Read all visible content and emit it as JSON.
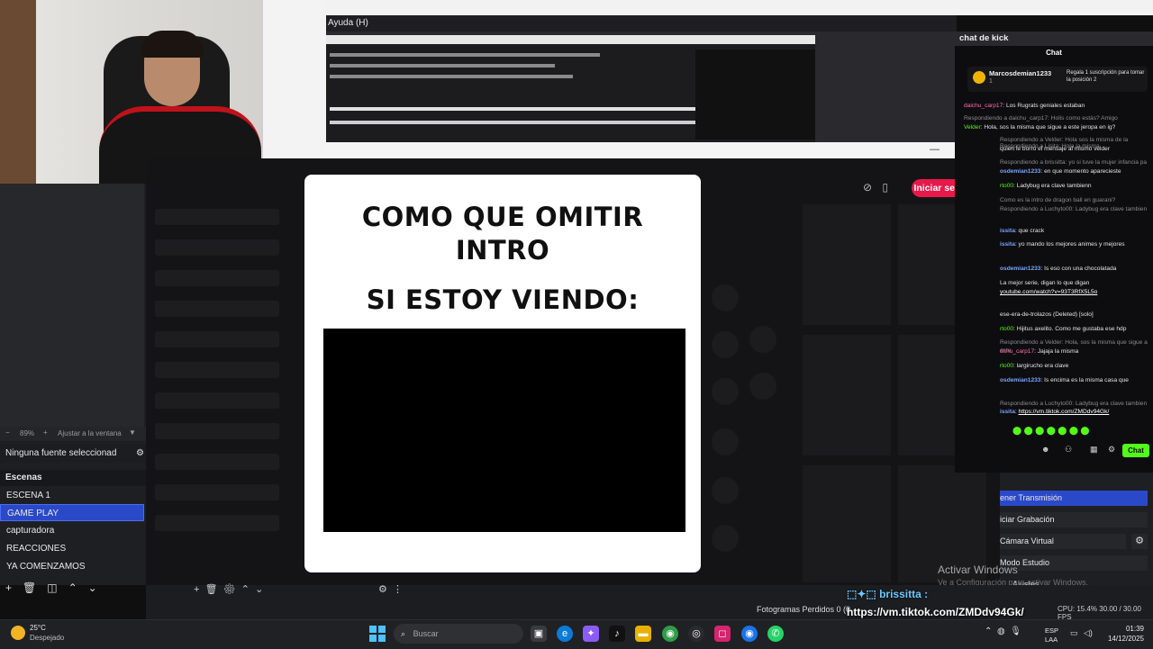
{
  "menu": {
    "help": "Ayuda (H)"
  },
  "chat_dock": {
    "title": "chat de kick",
    "header": "Chat",
    "sub_user": "Marcosdemian1233",
    "sub_count": "1",
    "sub_text": "Regala 1 suscripción para tomar la posición 2",
    "messages": [
      {
        "user": "daichu_carp17",
        "text": "Los Rugrats geniales estaban"
      },
      {
        "user": "",
        "text": "Respondiendo a daichu_carp17: Holis como estás? Amigo"
      },
      {
        "user": "Velder",
        "text": "Hola, sos la misma que sigue a este jeropa en ig?"
      },
      {
        "user": "",
        "text": "Respondiendo a Velder: Hola sos la misma de la"
      },
      {
        "user": "",
        "text": "Respondiendo a Lisita: Hola la misma"
      },
      {
        "user": "",
        "text": "quien le borro el mensaje al mismo velder"
      },
      {
        "user": "",
        "text": "Respondiendo a brissitta: yo si tuve la mujer infancia pa"
      },
      {
        "user": "osdemian1233",
        "text": "en que momento aparecieste"
      },
      {
        "user": "rto00",
        "text": "Ladybug era clave tambienn"
      },
      {
        "user": "",
        "text": "Como es la intro de dragon ball en guarani?"
      },
      {
        "user": "",
        "text": "Respondiendo a Luchyto00: Ladybug era clave tambien"
      },
      {
        "user": "issita",
        "text": "que crack"
      },
      {
        "user": "issita",
        "text": "yo mando los mejores animes y mejores"
      },
      {
        "user": "osdemian1233",
        "text": "Is eso con una chocolatada"
      },
      {
        "user": "",
        "text": "La mejor serie, digan lo que digan"
      },
      {
        "user": "",
        "text": "youtube.com/watch?v=93T3RfX5L5o"
      },
      {
        "user": "",
        "text": "ese-era-de-trolazos (Deleted) [solo]"
      },
      {
        "user": "rto00",
        "text": "Hijitus axelito. Como me gustaba ese hdp"
      },
      {
        "user": "",
        "text": "Respondiendo a Velder: Hola, sos la misma que sigue a este"
      },
      {
        "user": "dchu_carp17",
        "text": "Jajaja la misma"
      },
      {
        "user": "rto00",
        "text": "largirucho era clave"
      },
      {
        "user": "osdemian1233",
        "text": "Is encima es la misma casa que"
      },
      {
        "user": "",
        "text": "Respondiendo a Luchyto00: Ladybug era clave tambien"
      },
      {
        "user": "issita",
        "text": "https://vm.tiktok.com/ZMDdv94Gk/"
      }
    ],
    "send_label": "Chat"
  },
  "viewer": {
    "login": "Iniciar sesión",
    "card_line1": "COMO QUE OMITIR",
    "card_line2": "INTRO",
    "card_line3": "SI ESTOY VIENDO:"
  },
  "obs": {
    "zoom": "89%",
    "fit": "Ajustar a la ventana",
    "no_source": "Ninguna fuente seleccionad",
    "scenes_label": "Escenas",
    "scenes": [
      "ESCENA 1",
      "GAME PLAY",
      "capturadora",
      "REACCIONES",
      "YA COMENZAMOS"
    ],
    "selected_scene": "GAME PLAY",
    "controls": [
      "ener Transmisión",
      "iciar Grabación",
      "Cámara Virtual",
      "Modo Estudio",
      "Ajustes"
    ],
    "status_fps": "Fotogramas Perdidos 0 (0",
    "status_right": "CPU: 15.4%   30.00 / 30.00 FPS"
  },
  "overlay": {
    "name": "brissitta",
    "url": "https://vm.tiktok.com/ZMDdv94Gk/"
  },
  "watermark": {
    "line1": "Activar Windows",
    "line2": "Ve a Configuración para activar Windows."
  },
  "taskbar": {
    "temp": "25°C",
    "weather": "Despejado",
    "search": "Buscar",
    "lang1": "ESP",
    "lang2": "LAA",
    "time": "01:39",
    "date": "14/12/2025"
  }
}
